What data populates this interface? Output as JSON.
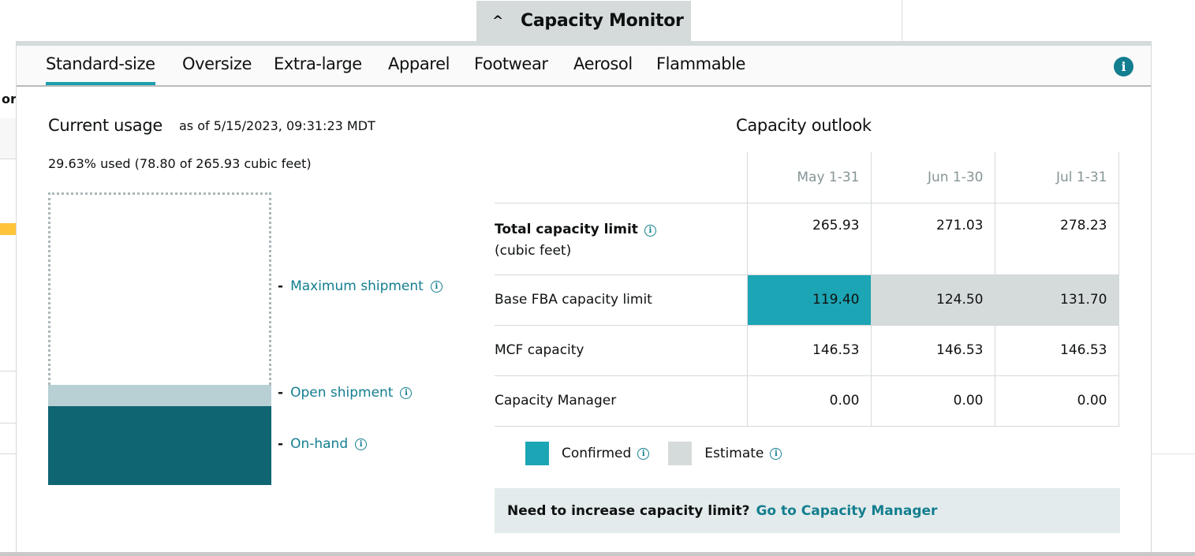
{
  "background": {
    "left_fragment_text": "or"
  },
  "header": {
    "toggle_icon": "chevron-up-icon",
    "toggle_glyph": "^",
    "title": "Capacity Monitor"
  },
  "tabs": [
    {
      "label": "Standard-size",
      "active": true
    },
    {
      "label": "Oversize",
      "active": false
    },
    {
      "label": "Extra-large",
      "active": false
    },
    {
      "label": "Apparel",
      "active": false
    },
    {
      "label": "Footwear",
      "active": false
    },
    {
      "label": "Aerosol",
      "active": false
    },
    {
      "label": "Flammable",
      "active": false
    }
  ],
  "info_glyph": "i",
  "current_usage": {
    "title": "Current usage",
    "as_of": "as of 5/15/2023, 09:31:23 MDT",
    "summary": "29.63% used (78.80 of 265.93 cubic feet)",
    "percent_used": 29.63,
    "used_cubic_feet": 78.8,
    "limit_cubic_feet": 265.93,
    "meter": {
      "on_hand_fraction": 0.27,
      "open_shipment_fraction": 0.0727,
      "labels": {
        "maximum_shipment": "Maximum shipment",
        "open_shipment": "Open shipment",
        "on_hand": "On-hand"
      },
      "dash": "-"
    },
    "colors": {
      "on_hand": "#106573",
      "open_shipment": "#b8d0d4",
      "maximum_border": "#aab7b8"
    }
  },
  "capacity_outlook": {
    "title": "Capacity outlook",
    "columns": [
      "May 1-31",
      "Jun 1-30",
      "Jul 1-31"
    ],
    "rows": [
      {
        "label": "Total capacity limit",
        "sublabel": "(cubic feet)",
        "values": [
          "265.93",
          "271.03",
          "278.23"
        ]
      },
      {
        "label": "Base FBA capacity limit",
        "values": [
          "119.40",
          "124.50",
          "131.70"
        ],
        "status": [
          "confirmed",
          "estimate",
          "estimate"
        ]
      },
      {
        "label": "MCF capacity",
        "values": [
          "146.53",
          "146.53",
          "146.53"
        ]
      },
      {
        "label": "Capacity Manager",
        "values": [
          "0.00",
          "0.00",
          "0.00"
        ]
      }
    ],
    "legend": [
      {
        "label": "Confirmed",
        "color": "#1ca5b4"
      },
      {
        "label": "Estimate",
        "color": "#d5dbdb"
      }
    ],
    "cta": {
      "question": "Need to increase capacity limit?",
      "link": "Go to Capacity Manager"
    }
  }
}
